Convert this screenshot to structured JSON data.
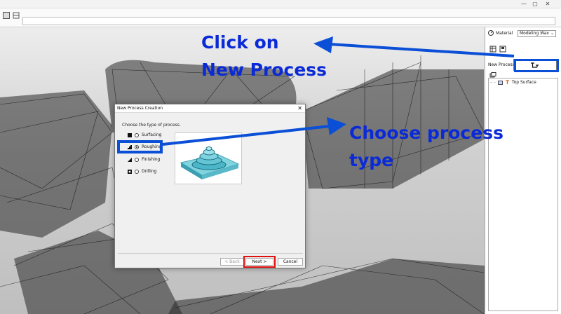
{
  "window": {
    "controls": [
      "—",
      "▢",
      "✕"
    ]
  },
  "panel": {
    "material_label": "Material",
    "material_value": "Modeling Wax",
    "new_process_label": "New Process",
    "tree_items": [
      {
        "label": "Top Surface"
      }
    ]
  },
  "dialog": {
    "title": "New Process Creation",
    "prompt": "Choose the type of process.",
    "options": [
      {
        "label": "Surfacing",
        "selected": false
      },
      {
        "label": "Roughing",
        "selected": true
      },
      {
        "label": "Finishing",
        "selected": false
      },
      {
        "label": "Drilling",
        "selected": false
      }
    ],
    "back_label": "< Back",
    "next_label": "Next >",
    "cancel_label": "Cancel"
  },
  "annotations": {
    "click_line1": "Click on",
    "click_line2": "New Process",
    "choose_line1": "Choose process",
    "choose_line2": "type",
    "arrow_color": "#0a4fd6",
    "text_color": "#0a2ad8",
    "next_highlight_color": "#e01010"
  }
}
